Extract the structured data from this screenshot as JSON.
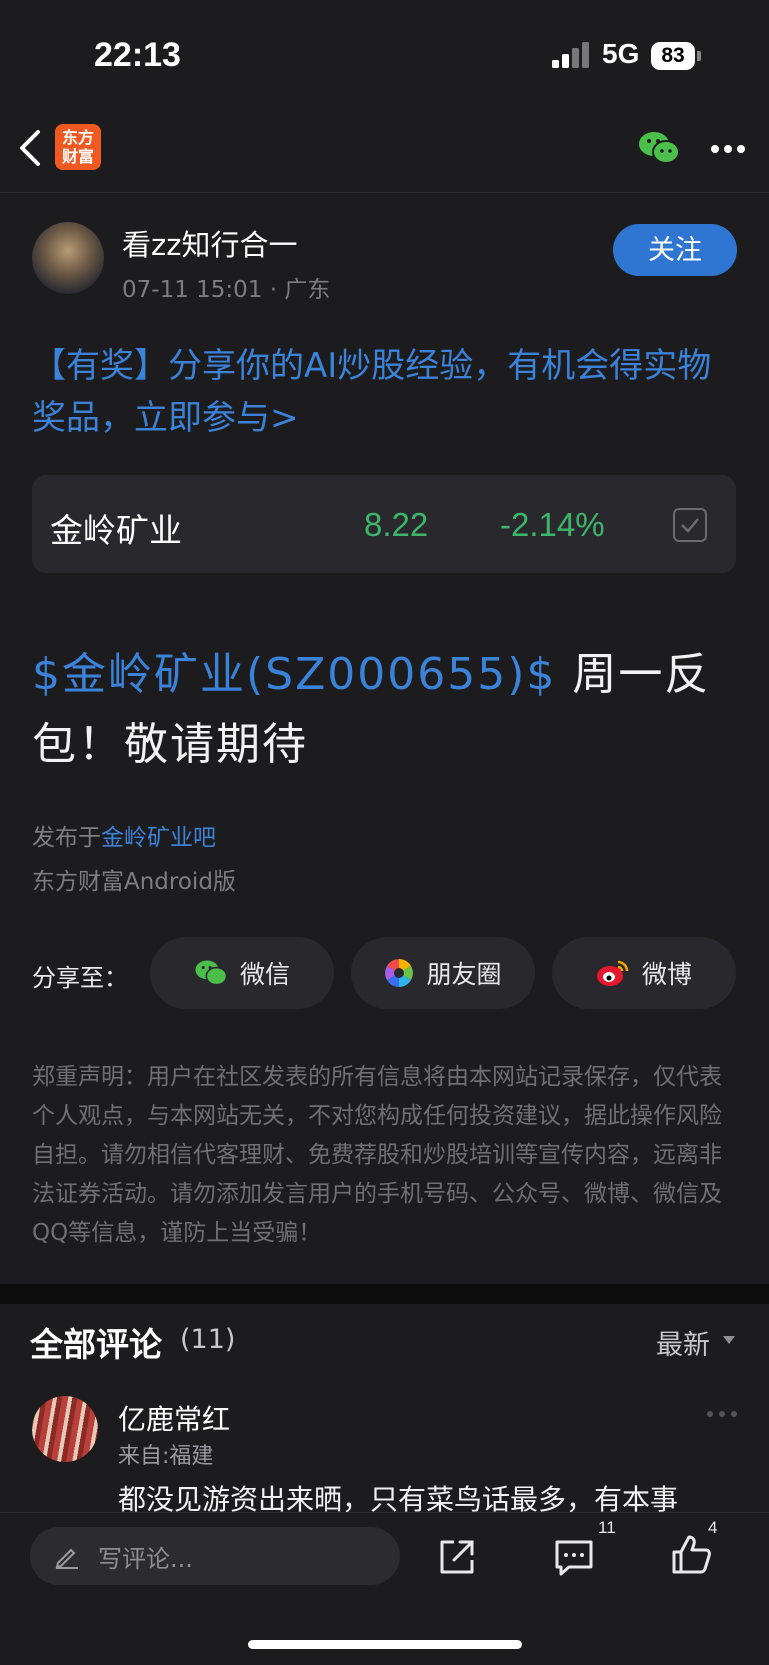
{
  "status_bar": {
    "time": "22:13",
    "network": "5G",
    "battery": "83"
  },
  "nav": {
    "logo_line1": "东方",
    "logo_line2": "财富"
  },
  "author": {
    "name": "看zz知行合一",
    "meta": "07-11 15:01 · 广东",
    "follow_label": "关注"
  },
  "promo": {
    "text": "【有奖】分享你的AI炒股经验，有机会得实物奖品，立即参与>"
  },
  "stock": {
    "name": "金岭矿业",
    "price": "8.22",
    "change": "-2.14%"
  },
  "post": {
    "tag": "$金岭矿业(SZ000655)$",
    "text": " 周一反包！敬请期待",
    "published_prefix": "发布于",
    "published_forum": "金岭矿业吧",
    "client": "东方财富Android版"
  },
  "share": {
    "label": "分享至：",
    "wechat": "微信",
    "moments": "朋友圈",
    "weibo": "微博"
  },
  "disclaimer": "郑重声明：用户在社区发表的所有信息将由本网站记录保存，仅代表个人观点，与本网站无关，不对您构成任何投资建议，据此操作风险自担。请勿相信代客理财、免费荐股和炒股培训等宣传内容，远离非法证券活动。请勿添加发言用户的手机号码、公众号、微博、微信及QQ等信息，谨防上当受骗！",
  "comments": {
    "title": "全部评论",
    "count": "(11)",
    "sort": "最新",
    "items": [
      {
        "name": "亿鹿常红",
        "from": "来自:福建",
        "text": "都没见游资出来晒，只有菜鸟话最多，有本事"
      }
    ]
  },
  "bottom_bar": {
    "placeholder": "写评论...",
    "comment_count": "11",
    "like_count": "4"
  },
  "colors": {
    "accent": "#2f76d2",
    "link": "#3b82d9",
    "down": "#3db66b",
    "logo": "#f05a22"
  }
}
